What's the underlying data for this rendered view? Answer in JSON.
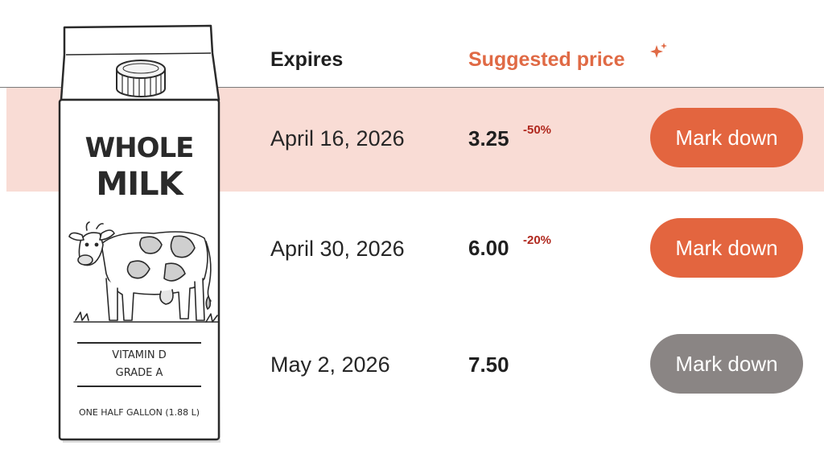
{
  "header": {
    "expires_label": "Expires",
    "suggested_price_label": "Suggested price",
    "sparkle_icon": "sparkle-icon"
  },
  "product": {
    "title_line1": "WHOLE",
    "title_line2": "MILK",
    "info_line1": "VITAMIN D",
    "info_line2": "GRADE A",
    "size": "ONE HALF GALLON (1.88 L)",
    "icon": "cow-illustration"
  },
  "rows": [
    {
      "expires": "April 16, 2026",
      "price": "3.25",
      "discount": "-50%",
      "button_label": "Mark down",
      "highlighted": true,
      "enabled": true
    },
    {
      "expires": "April 30, 2026",
      "price": "6.00",
      "discount": "-20%",
      "button_label": "Mark down",
      "highlighted": false,
      "enabled": true
    },
    {
      "expires": "May 2, 2026",
      "price": "7.50",
      "discount": "",
      "button_label": "Mark down",
      "highlighted": false,
      "enabled": false
    }
  ],
  "colors": {
    "accent": "#e3653f",
    "highlight_row": "#f9dcd5",
    "discount": "#b0281e",
    "disabled_button": "#8a8584"
  }
}
